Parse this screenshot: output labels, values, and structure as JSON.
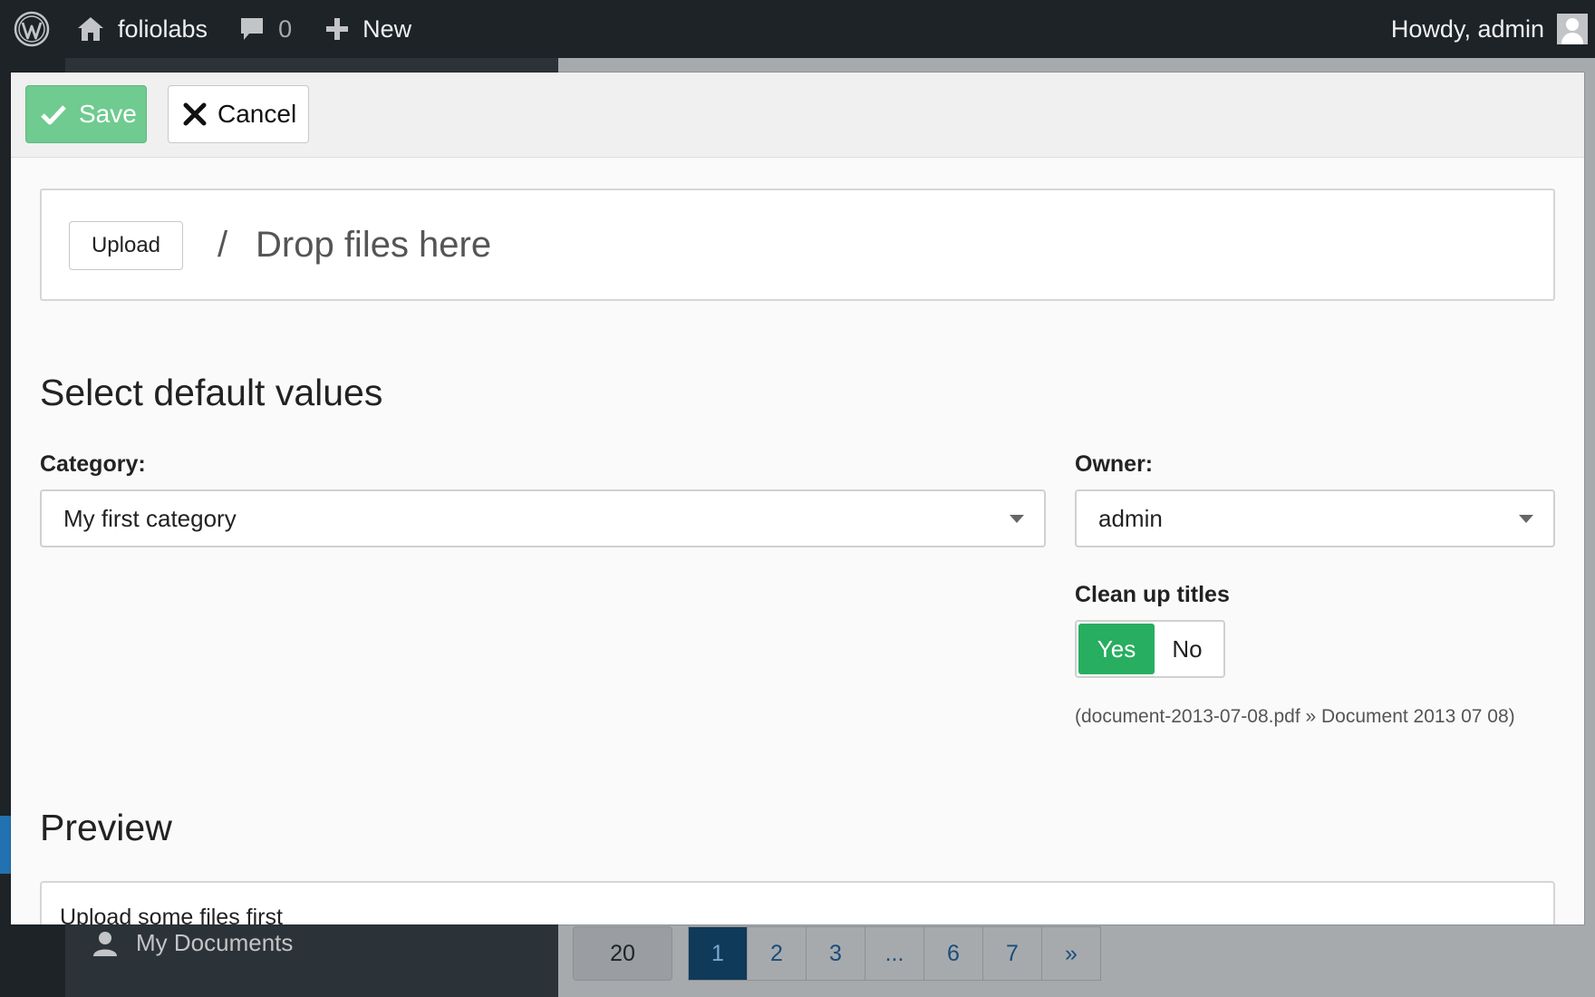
{
  "admin_bar": {
    "site_name": "foliolabs",
    "comments_count": "0",
    "new_label": "New",
    "howdy": "Howdy, admin"
  },
  "background": {
    "sidebar_item": "My Documents",
    "per_page": "20",
    "pagination": [
      "1",
      "2",
      "3",
      "...",
      "6",
      "7",
      "»"
    ]
  },
  "toolbar": {
    "save_label": "Save",
    "cancel_label": "Cancel"
  },
  "dropzone": {
    "upload_label": "Upload",
    "separator": "/",
    "drop_text": "Drop files here"
  },
  "defaults": {
    "heading": "Select default values",
    "category_label": "Category:",
    "category_value": "My first category",
    "owner_label": "Owner:",
    "owner_value": "admin",
    "cleanup_label": "Clean up titles",
    "cleanup_yes": "Yes",
    "cleanup_no": "No",
    "cleanup_selected": "Yes",
    "cleanup_hint": "(document-2013-07-08.pdf » Document 2013 07 08)"
  },
  "preview": {
    "heading": "Preview",
    "empty_text": "Upload some files first"
  },
  "colors": {
    "admin_bar_bg": "#1d2327",
    "save_bg": "#6fcb8f",
    "toggle_on": "#27ae60"
  }
}
